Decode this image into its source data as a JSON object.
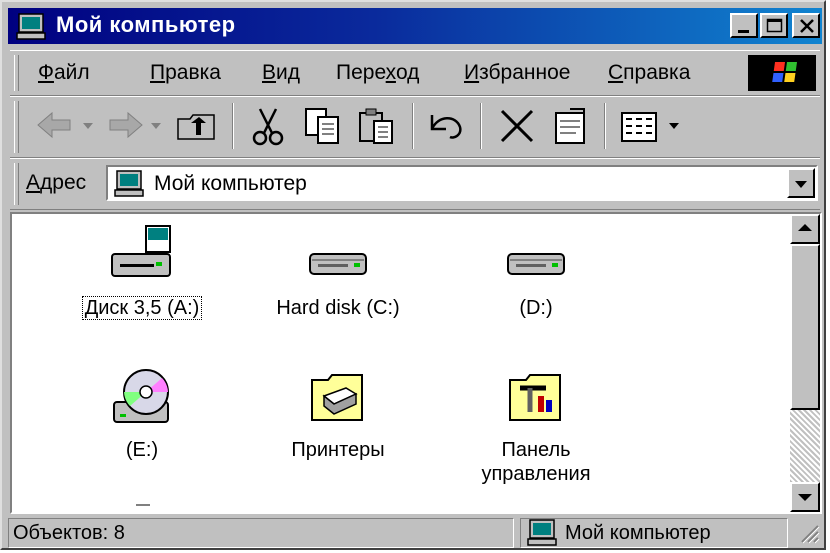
{
  "window": {
    "title": "Мой компьютер"
  },
  "menu": {
    "items": [
      {
        "key": "Ф",
        "rest": "айл"
      },
      {
        "key": "П",
        "rest": "равка"
      },
      {
        "key": "В",
        "rest": "ид"
      },
      {
        "pre": "Пере",
        "key": "х",
        "rest": "од"
      },
      {
        "key": "И",
        "rest": "збранное"
      },
      {
        "key": "С",
        "rest": "правка"
      }
    ]
  },
  "address": {
    "label_key": "А",
    "label_rest": "дрес",
    "value": "Мой компьютер"
  },
  "items": [
    {
      "label": "Диск 3,5 (A:)",
      "icon": "floppy-drive-icon"
    },
    {
      "label": "Hard disk (C:)",
      "icon": "hard-disk-icon"
    },
    {
      "label": "(D:)",
      "icon": "hard-disk-icon"
    },
    {
      "label": "(E:)",
      "icon": "cd-drive-icon"
    },
    {
      "label": "Принтеры",
      "icon": "printers-folder-icon"
    },
    {
      "label": "Панель управления",
      "icon": "control-panel-folder-icon"
    }
  ],
  "status": {
    "objects": "Объектов: 8",
    "location": "Мой компьютер"
  },
  "colors": {
    "title_start": "#000080",
    "title_end": "#1084d0",
    "face": "#c0c0c0"
  }
}
